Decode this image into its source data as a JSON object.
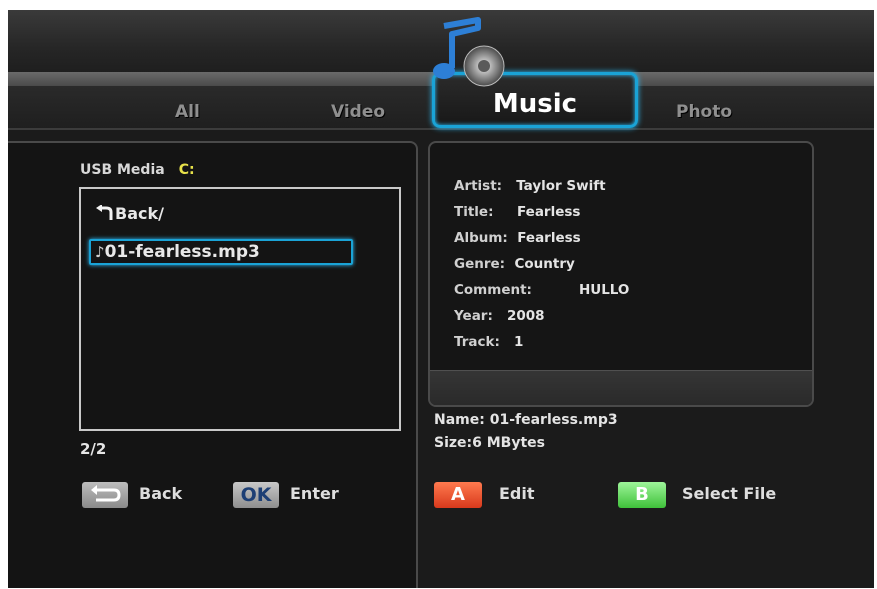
{
  "tabs": [
    {
      "label": "All"
    },
    {
      "label": "Video"
    },
    {
      "label": "Music"
    },
    {
      "label": "Photo"
    }
  ],
  "browser": {
    "device_label": "USB Media",
    "drive": "C:",
    "back_label": "Back/",
    "selected_file": "01-fearless.mp3",
    "counter": "2/2"
  },
  "info": {
    "artist": {
      "label": "Artist:",
      "value": "Taylor Swift"
    },
    "title": {
      "label": "Title:",
      "value": "Fearless"
    },
    "album": {
      "label": "Album:",
      "value": "Fearless"
    },
    "genre": {
      "label": "Genre:",
      "value": "Country"
    },
    "comment": {
      "label": "Comment:",
      "value": "HULLO"
    },
    "year": {
      "label": "Year:",
      "value": "2008"
    },
    "track": {
      "label": "Track:",
      "value": "1"
    }
  },
  "file_details": {
    "name_label": "Name:",
    "name_value": "01-fearless.mp3",
    "size_label": "Size:",
    "size_value": "6  MBytes"
  },
  "hints": {
    "back_label": "Back",
    "ok_key": "OK",
    "enter_label": "Enter",
    "a_key": "A",
    "edit_label": "Edit",
    "b_key": "B",
    "select_label": "Select File"
  },
  "colors": {
    "accent_blue": "#1aa3d6",
    "key_a": "#e4482a",
    "key_b": "#5ad455",
    "drive_yellow": "#e8e24a"
  },
  "icons": [
    "music-note-icon",
    "back-arrow-icon",
    "music-file-icon",
    "return-key-icon"
  ]
}
